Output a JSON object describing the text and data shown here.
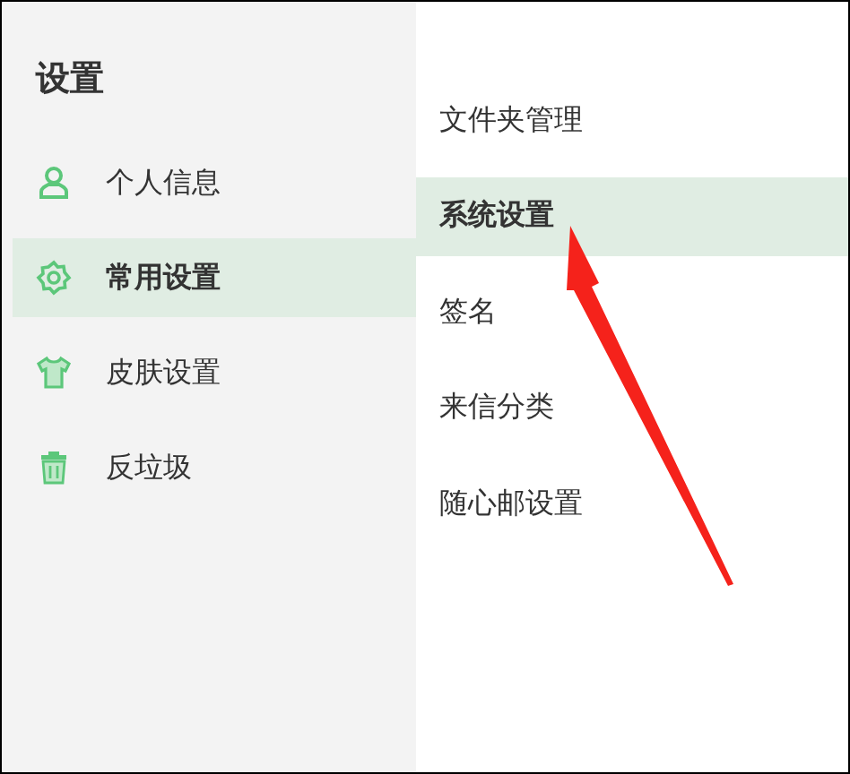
{
  "sidebar": {
    "title": "设置",
    "items": [
      {
        "label": "个人信息",
        "selected": false
      },
      {
        "label": "常用设置",
        "selected": true
      },
      {
        "label": "皮肤设置",
        "selected": false
      },
      {
        "label": "反垃圾",
        "selected": false
      }
    ]
  },
  "submenu": {
    "items": [
      {
        "label": "文件夹管理",
        "selected": false
      },
      {
        "label": "系统设置",
        "selected": true
      },
      {
        "label": "签名",
        "selected": false
      },
      {
        "label": "来信分类",
        "selected": false
      },
      {
        "label": "随心邮设置",
        "selected": false
      }
    ]
  }
}
